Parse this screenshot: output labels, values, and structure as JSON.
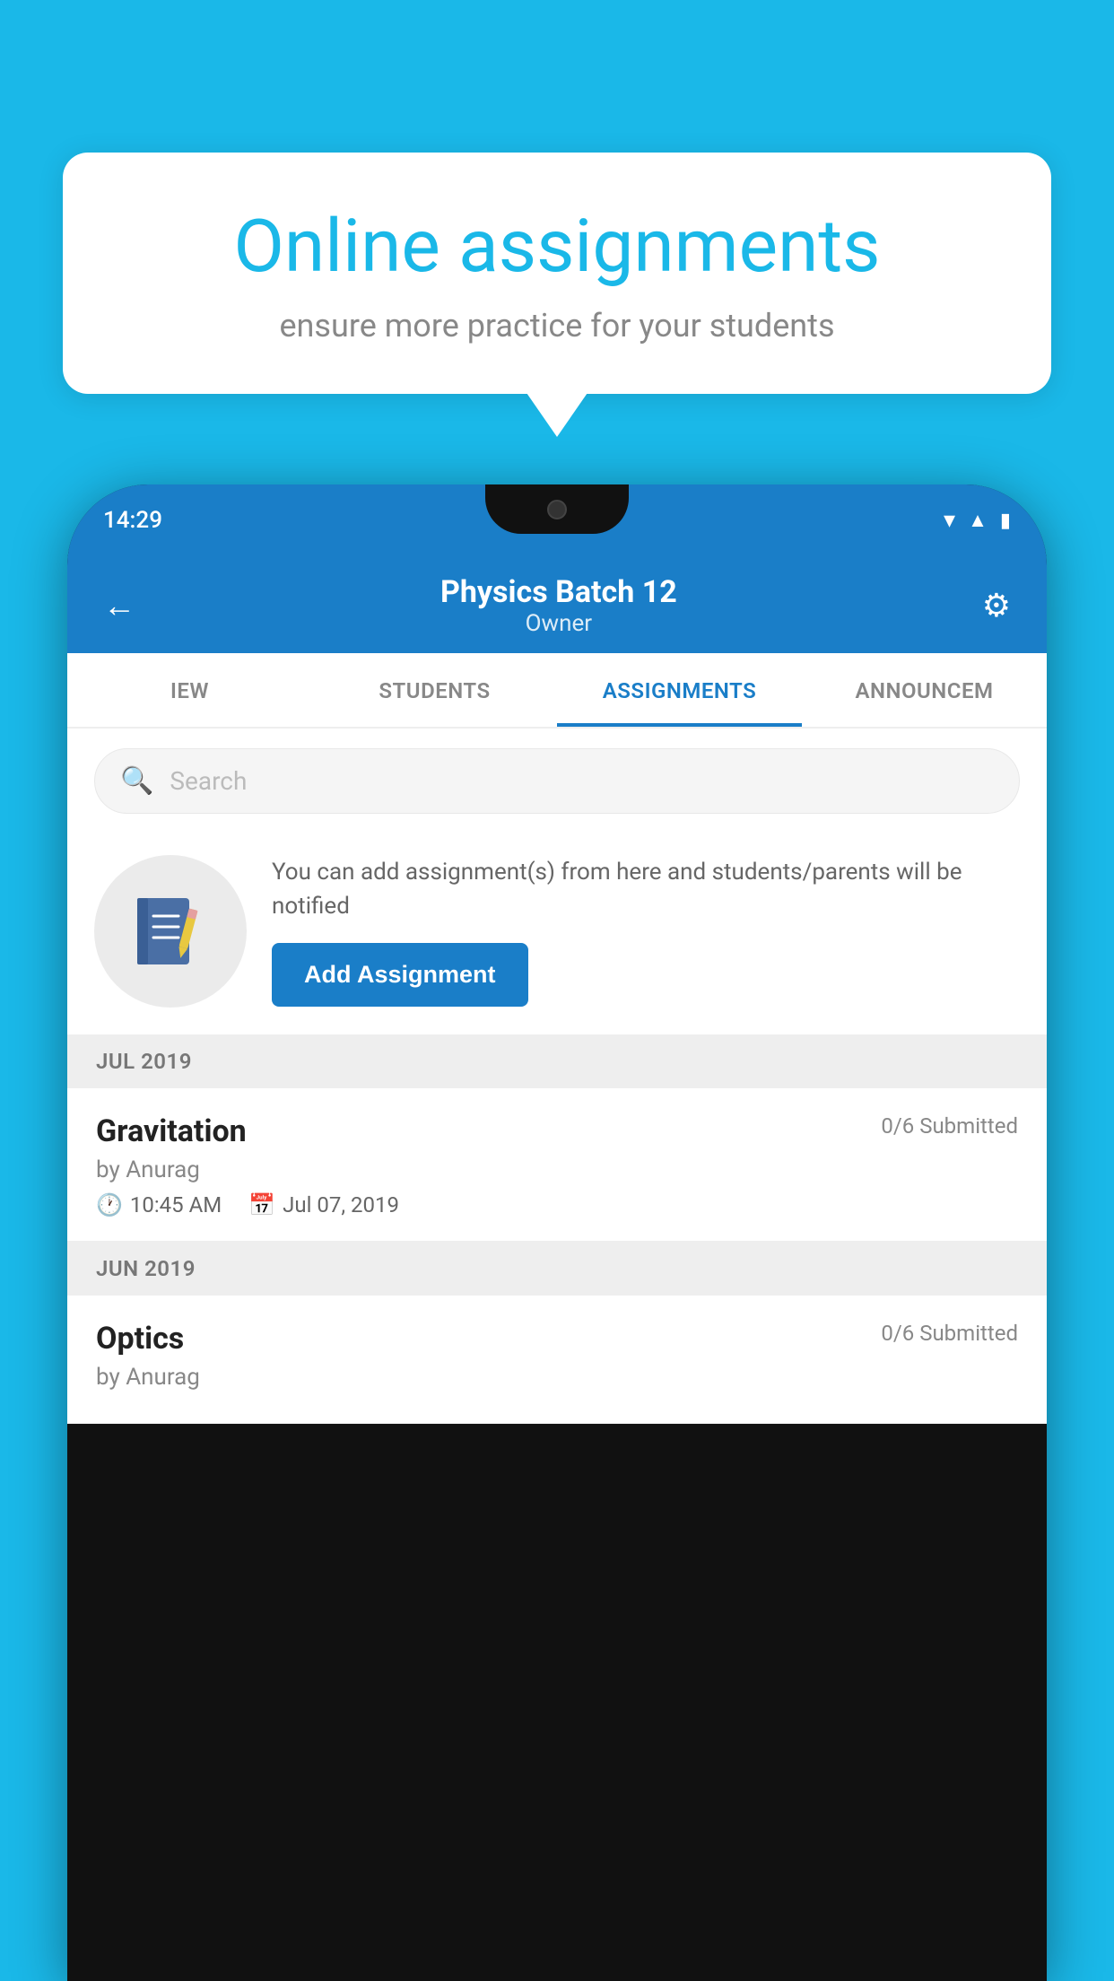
{
  "background_color": "#1ab8e8",
  "bubble": {
    "title": "Online assignments",
    "subtitle": "ensure more practice for your students"
  },
  "phone": {
    "status_bar": {
      "time": "14:29"
    },
    "header": {
      "title": "Physics Batch 12",
      "subtitle": "Owner",
      "back_label": "←",
      "settings_label": "⚙"
    },
    "tabs": [
      {
        "label": "IEW",
        "active": false
      },
      {
        "label": "STUDENTS",
        "active": false
      },
      {
        "label": "ASSIGNMENTS",
        "active": true
      },
      {
        "label": "ANNOUNCEM",
        "active": false
      }
    ],
    "search": {
      "placeholder": "Search"
    },
    "info_card": {
      "description": "You can add assignment(s) from here and students/parents will be notified",
      "button_label": "Add Assignment"
    },
    "sections": [
      {
        "label": "JUL 2019",
        "assignments": [
          {
            "title": "Gravitation",
            "submitted": "0/6 Submitted",
            "author": "by Anurag",
            "time": "10:45 AM",
            "date": "Jul 07, 2019"
          }
        ]
      },
      {
        "label": "JUN 2019",
        "assignments": [
          {
            "title": "Optics",
            "submitted": "0/6 Submitted",
            "author": "by Anurag",
            "time": "",
            "date": ""
          }
        ]
      }
    ]
  }
}
